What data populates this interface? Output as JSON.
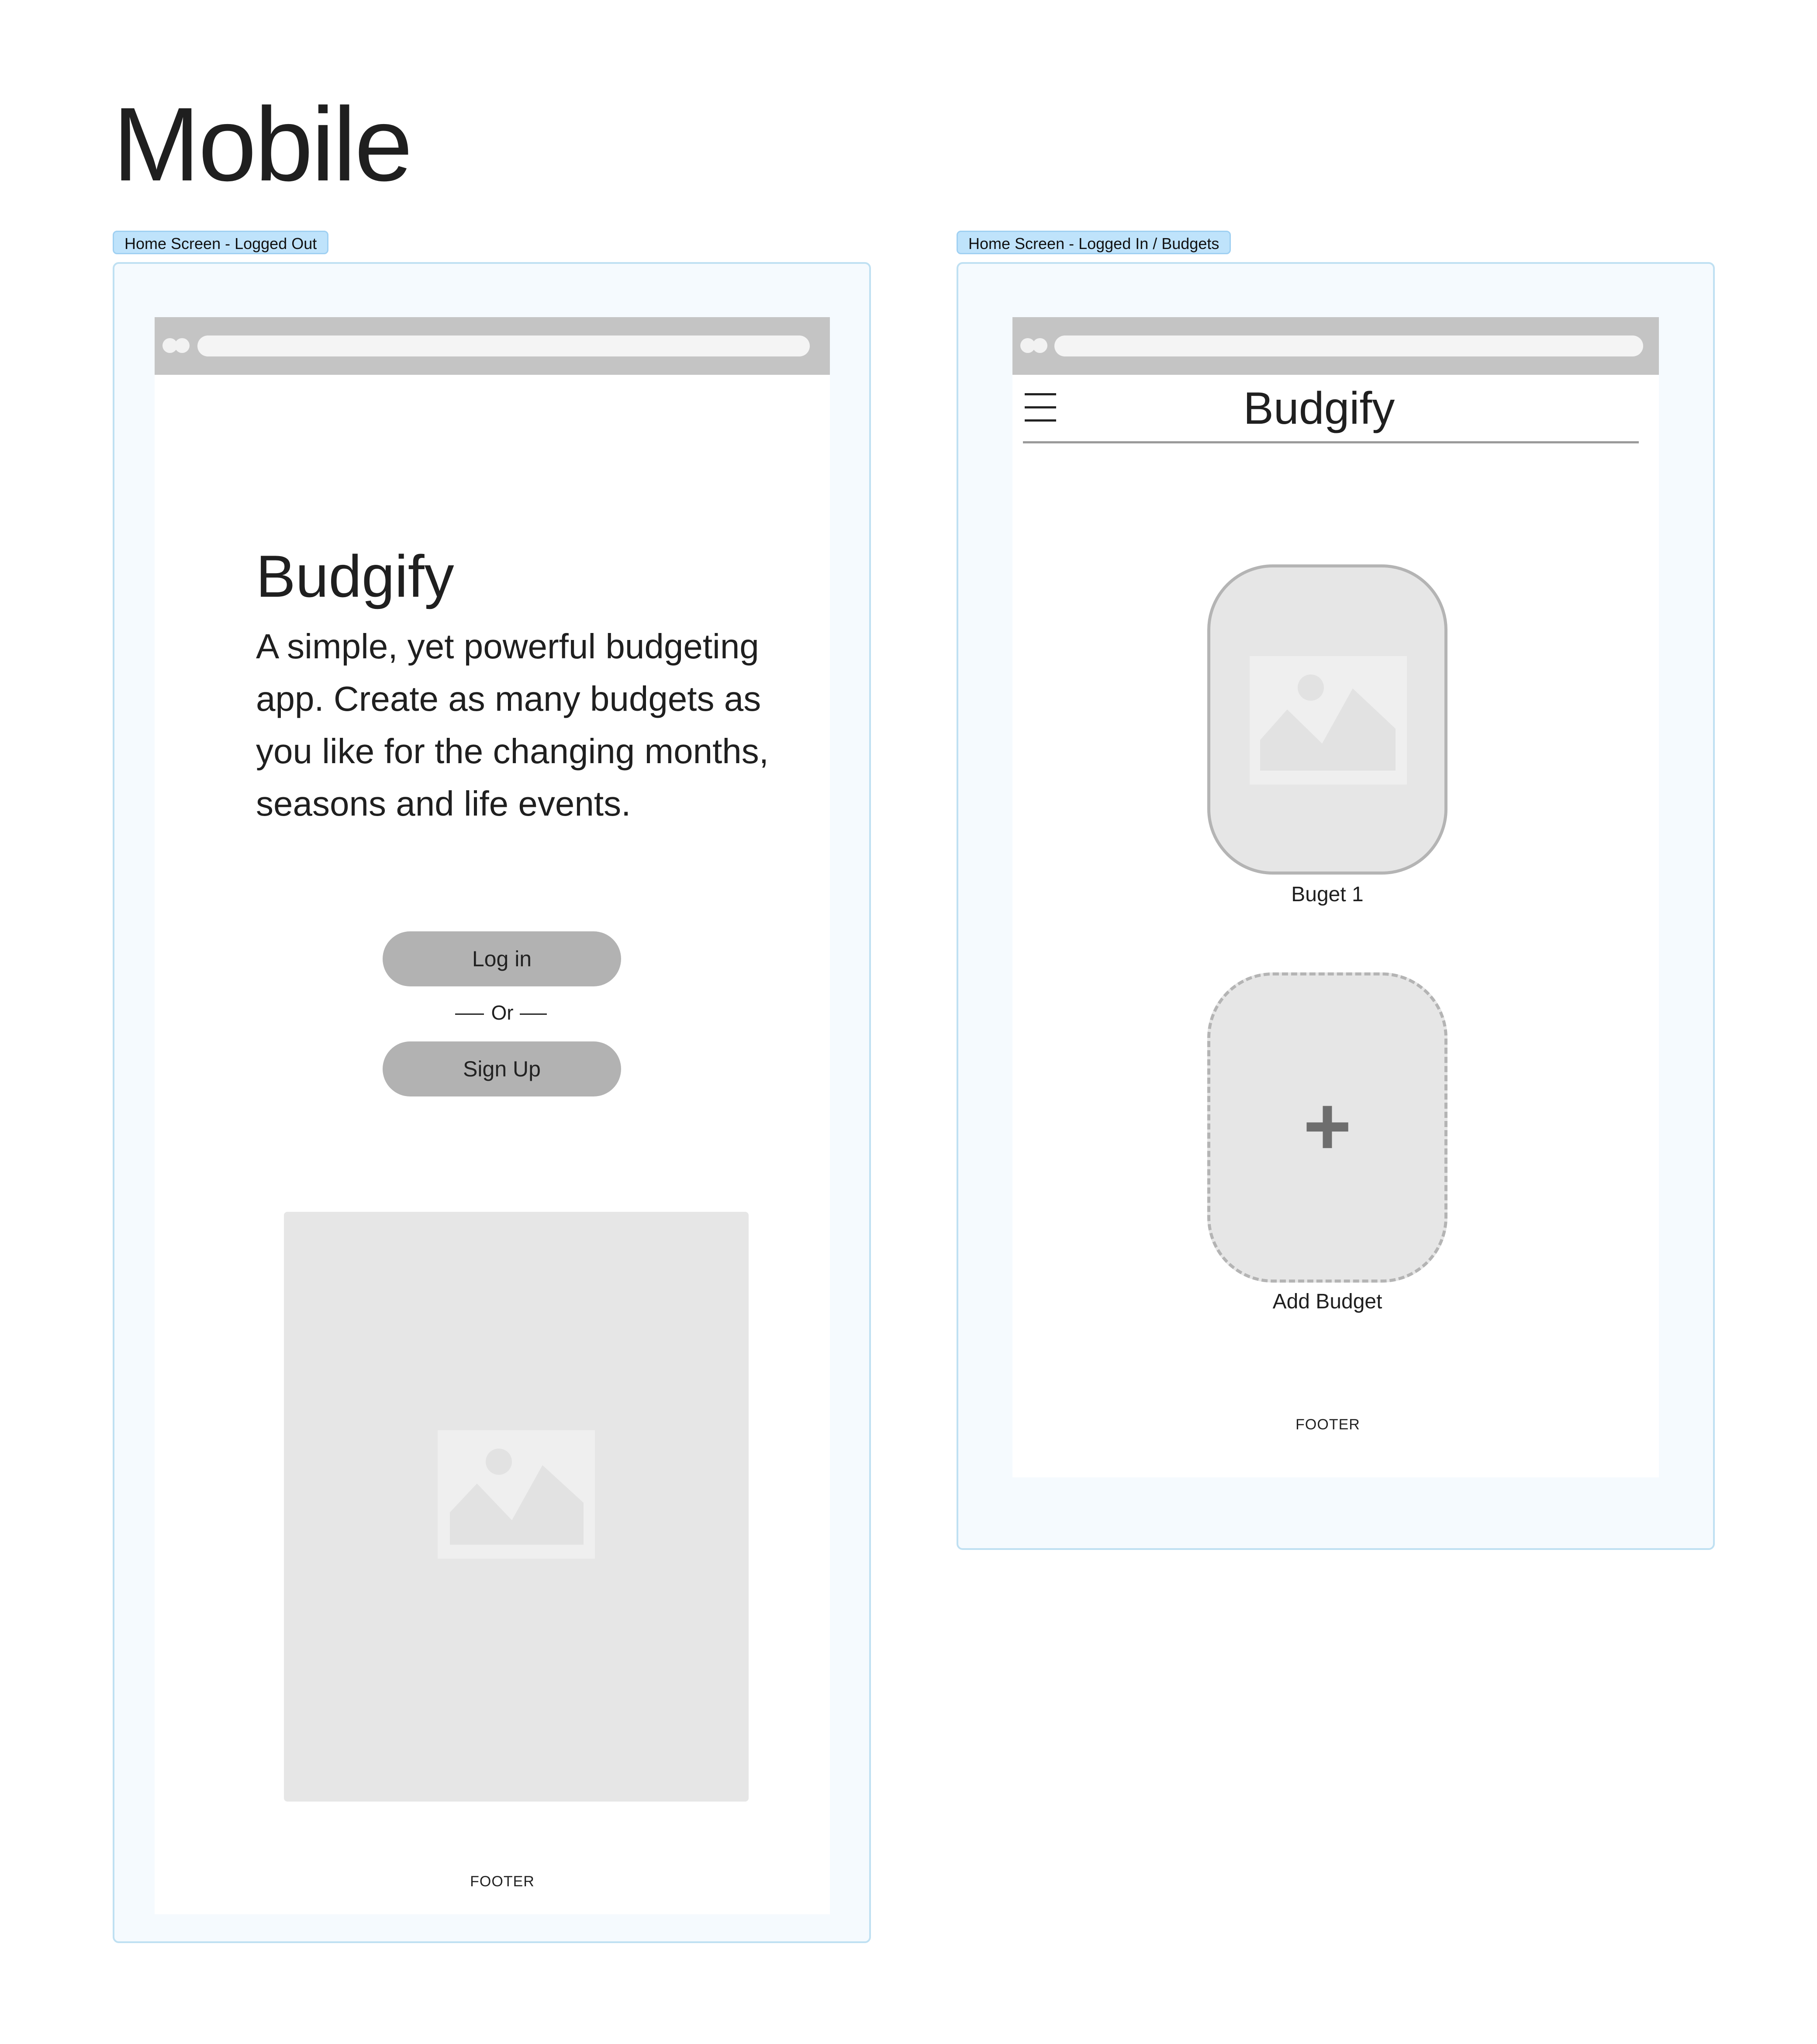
{
  "page": {
    "title": "Mobile"
  },
  "frames": {
    "logged_out": {
      "tag": "Home Screen - Logged Out",
      "hero": {
        "title": "Budgify",
        "description": "A simple, yet powerful budgeting app. Create as many budgets as you like for the changing months, seasons and life events."
      },
      "login_label": "Log in",
      "or_label": "Or",
      "signup_label": "Sign Up",
      "footer": "FOOTER"
    },
    "logged_in": {
      "tag": "Home Screen - Logged In / Budgets",
      "nav_title": "Budgify",
      "budgets": [
        {
          "label": "Buget 1"
        }
      ],
      "add_budget_label": "Add Budget",
      "add_icon": "+",
      "footer": "FOOTER"
    }
  },
  "colors": {
    "frame_border": "#bfe0f2",
    "tag_background": "#bfe3fb",
    "button_gray": "#b2b2b2",
    "placeholder_gray": "#e6e6e6"
  }
}
